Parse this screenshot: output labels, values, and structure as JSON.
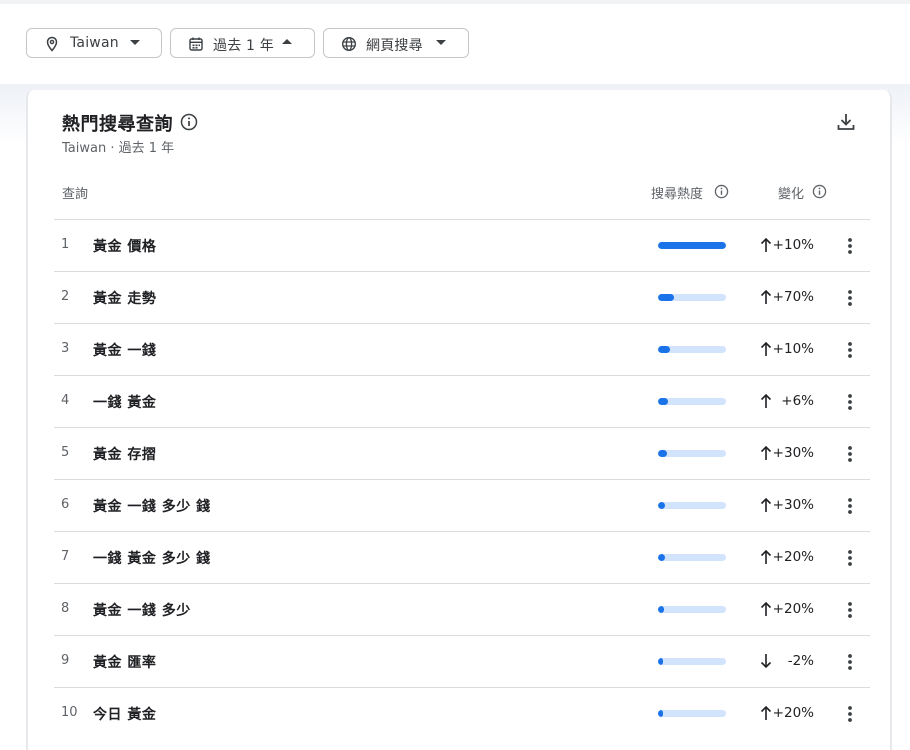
{
  "filters": {
    "location": "Taiwan",
    "time_range": "過去 1 年",
    "search_type": "網頁搜尋"
  },
  "card": {
    "title": "熱門搜尋查詢",
    "subtitle": "Taiwan · 過去 1 年"
  },
  "table": {
    "headers": {
      "query": "查詢",
      "interest": "搜尋熱度",
      "change": "變化"
    },
    "rows": [
      {
        "rank": "1",
        "query": "黃金 價格",
        "interest": 100,
        "direction": "up",
        "change": "+10%"
      },
      {
        "rank": "2",
        "query": "黃金 走勢",
        "interest": 23,
        "direction": "up",
        "change": "+70%"
      },
      {
        "rank": "3",
        "query": "黃金 一錢",
        "interest": 17,
        "direction": "up",
        "change": "+10%"
      },
      {
        "rank": "4",
        "query": "一錢 黃金",
        "interest": 15,
        "direction": "up",
        "change": "+6%"
      },
      {
        "rank": "5",
        "query": "黃金 存摺",
        "interest": 13,
        "direction": "up",
        "change": "+30%"
      },
      {
        "rank": "6",
        "query": "黃金 一錢 多少 錢",
        "interest": 11,
        "direction": "up",
        "change": "+30%"
      },
      {
        "rank": "7",
        "query": "一錢 黃金 多少 錢",
        "interest": 10,
        "direction": "up",
        "change": "+20%"
      },
      {
        "rank": "8",
        "query": "黃金 一錢 多少",
        "interest": 9,
        "direction": "up",
        "change": "+20%"
      },
      {
        "rank": "9",
        "query": "黃金 匯率",
        "interest": 8,
        "direction": "down",
        "change": "-2%"
      },
      {
        "rank": "10",
        "query": "今日 黃金",
        "interest": 8,
        "direction": "up",
        "change": "+20%"
      }
    ]
  },
  "colors": {
    "bar_fill": "#1a73e8",
    "bar_track": "#d2e3fc"
  }
}
